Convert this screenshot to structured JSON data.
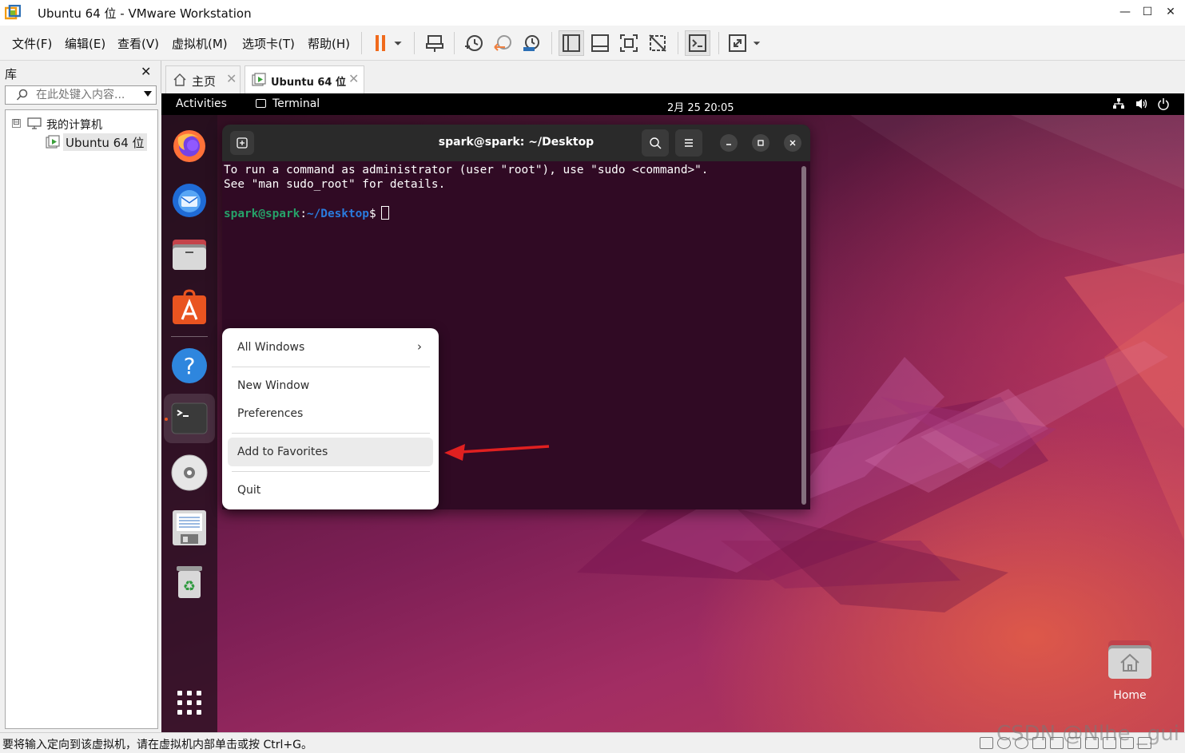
{
  "window": {
    "title": "Ubuntu 64 位 - VMware Workstation",
    "min": "—",
    "max": "☐",
    "close": "✕"
  },
  "menu": [
    "文件(F)",
    "编辑(E)",
    "查看(V)",
    "虚拟机(M)",
    "选项卡(T)",
    "帮助(H)"
  ],
  "library": {
    "title": "库",
    "close": "✕",
    "search_placeholder": "在此处键入内容...",
    "tree": {
      "toggle": "⊟",
      "root": "我的计算机",
      "vm": "Ubuntu 64 位"
    }
  },
  "tabs": [
    {
      "label": "主页",
      "close": "✕"
    },
    {
      "label": "Ubuntu 64 位",
      "close": "✕"
    }
  ],
  "ubuntu": {
    "activities": "Activities",
    "active_app": "Terminal",
    "clock": "2月 25  20:05",
    "terminal": {
      "title": "spark@spark: ~/Desktop",
      "line1": "To run a command as administrator (user \"root\"), use \"sudo <command>\".",
      "line2": "See \"man sudo_root\" for details.",
      "prompt_user": "spark@spark",
      "prompt_colon": ":",
      "prompt_path": "~/Desktop",
      "prompt_symbol": "$"
    },
    "context_menu": {
      "all_windows": "All Windows",
      "chevron": "›",
      "new_window": "New Window",
      "preferences": "Preferences",
      "add_to_favorites": "Add to Favorites",
      "quit": "Quit"
    },
    "desktop_home_label": "Home",
    "dock": [
      "firefox-icon",
      "thunderbird-icon",
      "files-icon",
      "app-center-icon",
      "help-icon",
      "terminal-icon",
      "disc-icon",
      "floppy-icon",
      "trash-icon",
      "app-grid-icon"
    ]
  },
  "statusbar": {
    "text": "要将输入定向到该虚拟机，请在虚拟机内部单击或按 Ctrl+G。",
    "watermark": "CSDN @Nlhe _gui"
  }
}
